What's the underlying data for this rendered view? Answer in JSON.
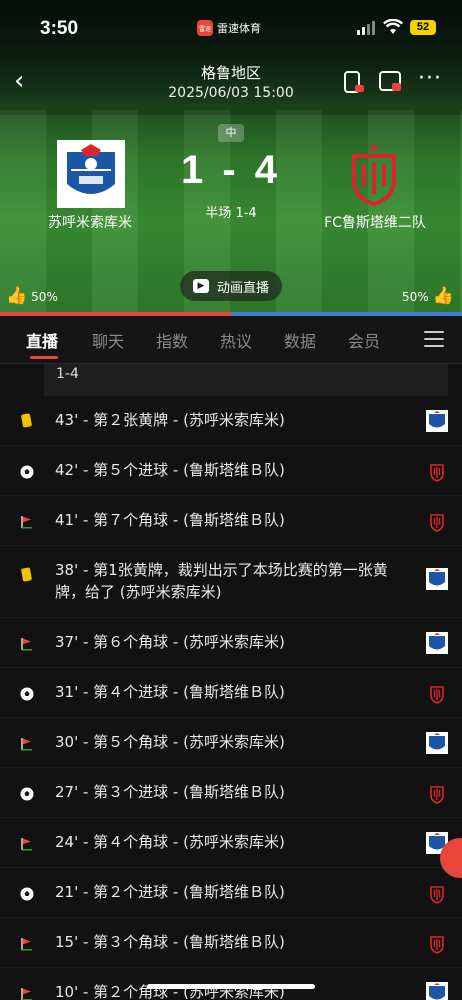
{
  "status_bar": {
    "time": "3:50",
    "app_name": "雷速体育",
    "app_logo_text": "雷速",
    "battery": "52"
  },
  "match": {
    "league": "格鲁地区",
    "datetime": "2025/06/03 15:00",
    "status": "中",
    "score": "1 - 4",
    "halftime": "半场 1-4",
    "home_team": "苏呼米索库米",
    "away_team": "FC鲁斯塔维二队",
    "home_vote": "50%",
    "away_vote": "50%",
    "home_possession": 0.5
  },
  "animation_button": "动画直播",
  "tabs": [
    {
      "label": "直播",
      "active": true
    },
    {
      "label": "聊天"
    },
    {
      "label": "指数"
    },
    {
      "label": "热议"
    },
    {
      "label": "数据"
    },
    {
      "label": "会员"
    }
  ],
  "feed": {
    "prev_text": "1-4",
    "events": [
      {
        "type": "yellow-card",
        "text": "43' - 第２张黄牌 - (苏呼米索库米)",
        "team": "home"
      },
      {
        "type": "goal",
        "text": "42' - 第５个进球 - (鲁斯塔维Ｂ队)",
        "team": "away"
      },
      {
        "type": "corner",
        "text": "41' - 第７个角球 - (鲁斯塔维Ｂ队)",
        "team": "away"
      },
      {
        "type": "yellow-card",
        "text": "38' - 第1张黄牌，裁判出示了本场比赛的第一张黄牌，给了 (苏呼米索库米)",
        "team": "home"
      },
      {
        "type": "corner",
        "text": "37' - 第６个角球 - (苏呼米索库米)",
        "team": "home"
      },
      {
        "type": "goal",
        "text": "31' - 第４个进球 - (鲁斯塔维Ｂ队)",
        "team": "away"
      },
      {
        "type": "corner",
        "text": "30' - 第５个角球 - (苏呼米索库米)",
        "team": "home"
      },
      {
        "type": "goal",
        "text": "27' - 第３个进球 - (鲁斯塔维Ｂ队)",
        "team": "away"
      },
      {
        "type": "corner",
        "text": "24' - 第４个角球 - (苏呼米索库米)",
        "team": "home"
      },
      {
        "type": "goal",
        "text": "21' - 第２个进球 - (鲁斯塔维Ｂ队)",
        "team": "away"
      },
      {
        "type": "corner",
        "text": "15' - 第３个角球 - (鲁斯塔维Ｂ队)",
        "team": "away"
      },
      {
        "type": "corner",
        "text": "10' - 第２个角球 - (苏呼米索库米)",
        "team": "home"
      }
    ]
  },
  "colors": {
    "accent": "#e8463a",
    "home_bar": "#e8463a",
    "away_bar": "#3b7fd6",
    "yellow_card": "#f2c200"
  }
}
